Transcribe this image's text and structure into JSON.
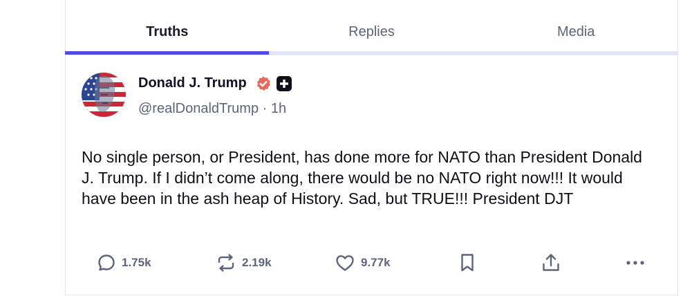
{
  "tabs": [
    {
      "label": "Truths",
      "active": true
    },
    {
      "label": "Replies",
      "active": false
    },
    {
      "label": "Media",
      "active": false
    }
  ],
  "post": {
    "author_name": "Donald J. Trump",
    "handle_line": "@realDonaldTrump · 1h",
    "body": "No single person, or President, has done more for NATO than President Donald J. Trump. If I didn’t come along, there would be no NATO right now!!! It would have been in the ash heap of History. Sad, but TRUE!!! President DJT",
    "badges": {
      "verified": "verified-badge-icon",
      "plus": "plus-badge-icon"
    },
    "actions": {
      "reply_count": "1.75k",
      "retruth_count": "2.19k",
      "like_count": "9.77k"
    }
  },
  "colors": {
    "accent": "#4d4fe2",
    "tab_track": "#e3e6fb",
    "verified": "#e66a5e",
    "muted_text": "#5d6379"
  }
}
